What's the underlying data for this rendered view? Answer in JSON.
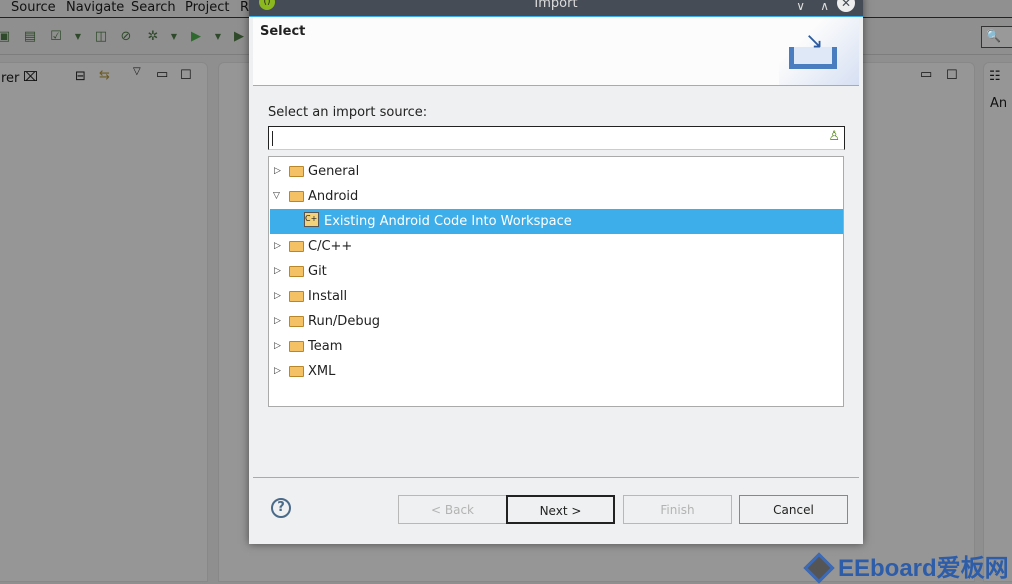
{
  "menu": [
    "Source",
    "Navigate",
    "Search",
    "Project",
    "R"
  ],
  "left_panel": {
    "tab": "rer"
  },
  "right_panel": {
    "text": "An c"
  },
  "dialog": {
    "title": "Import",
    "header": "Select",
    "label": "Select an import source:",
    "filter_value": "",
    "tree": [
      {
        "label": "General",
        "expanded": false,
        "level": 0
      },
      {
        "label": "Android",
        "expanded": true,
        "level": 0
      },
      {
        "label": "Existing Android Code Into Workspace",
        "level": 1,
        "selected": true
      },
      {
        "label": "C/C++",
        "expanded": false,
        "level": 0
      },
      {
        "label": "Git",
        "expanded": false,
        "level": 0
      },
      {
        "label": "Install",
        "expanded": false,
        "level": 0
      },
      {
        "label": "Run/Debug",
        "expanded": false,
        "level": 0
      },
      {
        "label": "Team",
        "expanded": false,
        "level": 0
      },
      {
        "label": "XML",
        "expanded": false,
        "level": 0
      }
    ],
    "buttons": {
      "back": "< Back",
      "next": "Next >",
      "finish": "Finish",
      "cancel": "Cancel"
    },
    "selection_color": "#3daee9"
  },
  "watermark": "EEboard爱板网"
}
